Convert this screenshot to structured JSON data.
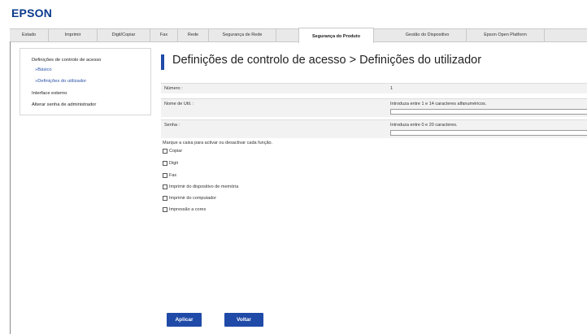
{
  "brand": {
    "logo_text": "EPSON",
    "color": "#0a3a8c",
    "accent": "#1f4aa8"
  },
  "tabs": [
    {
      "label": "Estado",
      "active": false
    },
    {
      "label": "Imprimir",
      "active": false
    },
    {
      "label": "Digit/Copiar",
      "active": false
    },
    {
      "label": "Fax",
      "active": false
    },
    {
      "label": "Rede",
      "active": false
    },
    {
      "label": "Segurança de Rede",
      "active": false
    },
    {
      "label": "Segurança do Produto",
      "active": true
    },
    {
      "label": "Gestão do Dispositivo",
      "active": false
    },
    {
      "label": "Epson Open Platform",
      "active": false
    }
  ],
  "sidebar": {
    "items": [
      {
        "label": "Definições de controlo de acesso"
      },
      {
        "label": "»Básico"
      },
      {
        "label": "»Definições do utilizador"
      },
      {
        "label": "Interface externo"
      },
      {
        "label": "Alterar senha de administrador"
      }
    ]
  },
  "main": {
    "title": "Definições de controlo de acesso > Definições do utilizador",
    "fields": {
      "number": {
        "label": "Número :",
        "value": "1"
      },
      "username": {
        "label": "Nome de Util. :",
        "hint": "Introduza entre 1 e 14 caracteres alfanuméricos.",
        "value": ""
      },
      "password": {
        "label": "Senha :",
        "hint": "Introduza entre 0 e 20 caracteres.",
        "value": ""
      }
    },
    "instruction": "Marque a caixa para activar ou desactivar cada função.",
    "checkboxes": [
      {
        "label": "Copiar",
        "checked": false
      },
      {
        "label": "Digit",
        "checked": false
      },
      {
        "label": "Fax",
        "checked": false
      },
      {
        "label": "Imprimir do dispositivo de memória",
        "checked": false
      },
      {
        "label": "Imprimir do computador",
        "checked": false
      },
      {
        "label": "Impressão a cores",
        "checked": false
      }
    ]
  },
  "buttons": {
    "apply": "Aplicar",
    "back": "Voltar"
  }
}
